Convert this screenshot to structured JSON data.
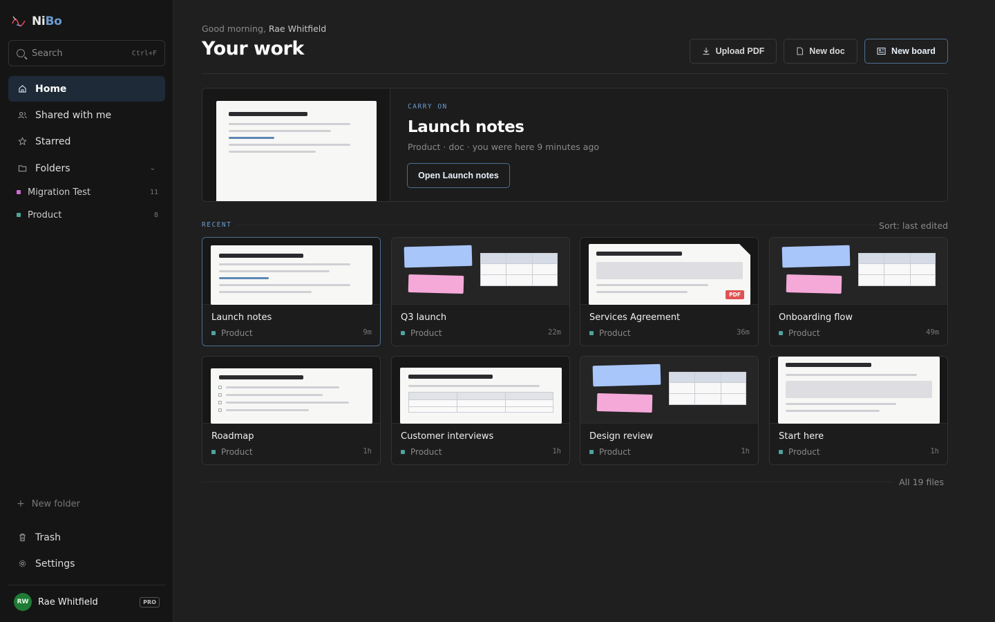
{
  "brand": {
    "name_a": "Ni",
    "name_b": "Bo"
  },
  "search": {
    "placeholder": "Search",
    "shortcut": "Ctrl+F"
  },
  "nav": {
    "home": "Home",
    "shared": "Shared with me",
    "starred": "Starred",
    "folders": "Folders"
  },
  "folders": [
    {
      "name": "Migration Test",
      "count": "11",
      "color": "#d26ad0"
    },
    {
      "name": "Product",
      "count": "8",
      "color": "#4fa39d"
    }
  ],
  "sidebar_bottom": {
    "new_folder": "New folder",
    "trash": "Trash",
    "settings": "Settings"
  },
  "user": {
    "initials": "RW",
    "name": "Rae Whitfield",
    "plan": "PRO"
  },
  "header": {
    "greeting_prefix": "Good morning,",
    "greeting_name": "Rae Whitfield",
    "title": "Your work",
    "upload_pdf": "Upload PDF",
    "new_doc": "New doc",
    "new_board": "New board"
  },
  "carry_on": {
    "eyebrow": "CARRY ON",
    "title": "Launch notes",
    "meta": "Product · doc · you were here 9 minutes ago",
    "button": "Open Launch notes"
  },
  "recent": {
    "label": "RECENT",
    "sort": "Sort: last edited",
    "cards": [
      {
        "title": "Launch notes",
        "folder": "Product",
        "time": "9m"
      },
      {
        "title": "Q3 launch",
        "folder": "Product",
        "time": "22m"
      },
      {
        "title": "Services Agreement",
        "folder": "Product",
        "time": "36m"
      },
      {
        "title": "Onboarding flow",
        "folder": "Product",
        "time": "49m"
      },
      {
        "title": "Roadmap",
        "folder": "Product",
        "time": "1h"
      },
      {
        "title": "Customer interviews",
        "folder": "Product",
        "time": "1h"
      },
      {
        "title": "Design review",
        "folder": "Product",
        "time": "1h"
      },
      {
        "title": "Start here",
        "folder": "Product",
        "time": "1h"
      }
    ],
    "pdf_badge": "PDF",
    "all_files": "All 19 files"
  },
  "colors": {
    "accent": "#6b9bd1",
    "active_nav": "#1e2a37",
    "product_folder": "#4fa39d",
    "migration_folder": "#d26ad0"
  }
}
